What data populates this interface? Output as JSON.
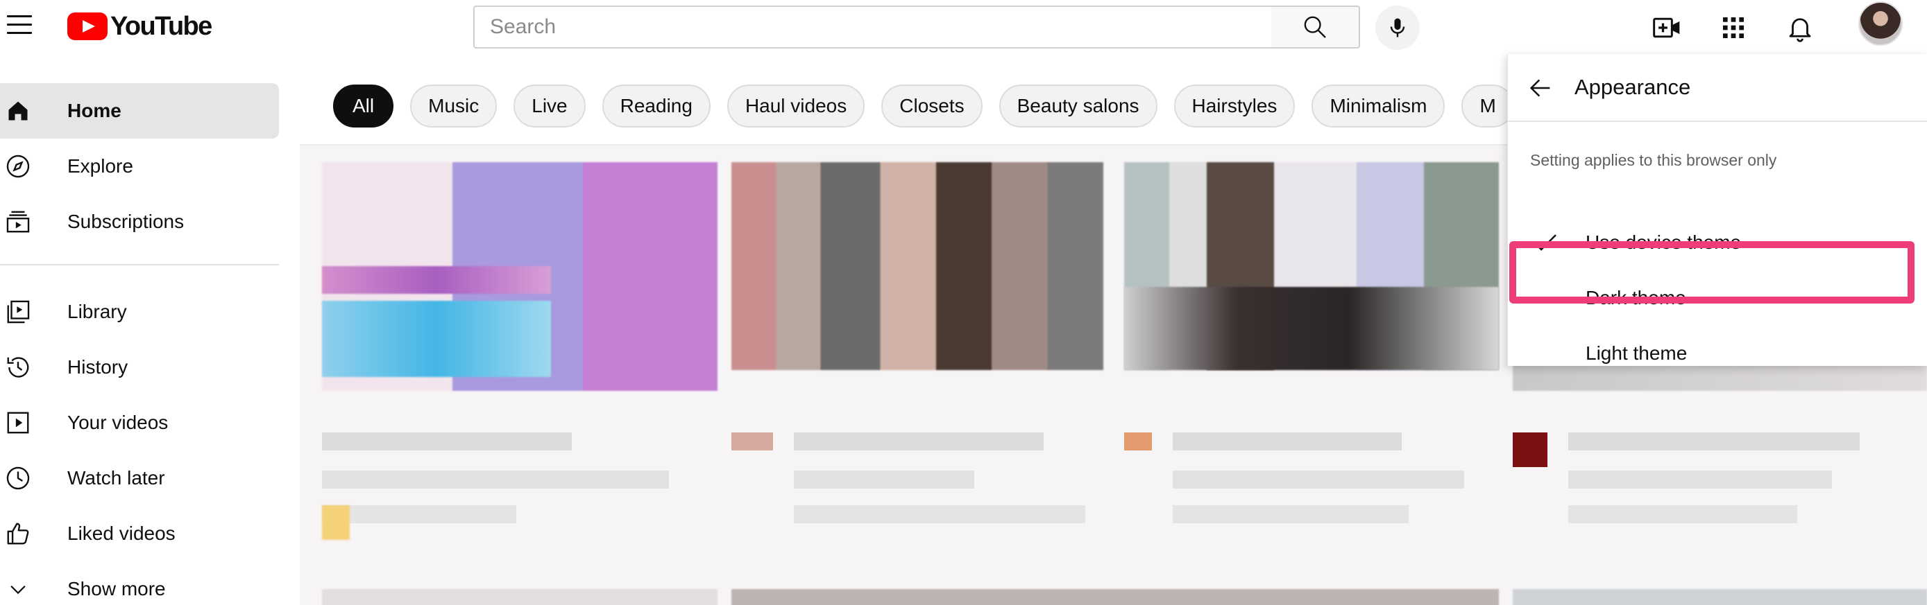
{
  "header": {
    "logo_text": "YouTube",
    "search_placeholder": "Search"
  },
  "icons": {
    "menu": "menu-icon",
    "search": "search-icon",
    "mic": "microphone-icon",
    "create": "create-video-icon",
    "apps": "apps-grid-icon",
    "notifications": "bell-icon"
  },
  "sidebar": {
    "items": [
      {
        "label": "Home",
        "icon": "home-icon",
        "active": true
      },
      {
        "label": "Explore",
        "icon": "compass-icon"
      },
      {
        "label": "Subscriptions",
        "icon": "subscriptions-icon"
      },
      {
        "label": "Library",
        "icon": "library-icon"
      },
      {
        "label": "History",
        "icon": "history-icon"
      },
      {
        "label": "Your videos",
        "icon": "your-videos-icon"
      },
      {
        "label": "Watch later",
        "icon": "clock-icon"
      },
      {
        "label": "Liked videos",
        "icon": "thumbs-up-icon"
      },
      {
        "label": "Show more",
        "icon": "chevron-down-icon"
      }
    ]
  },
  "chips": [
    "All",
    "Music",
    "Live",
    "Reading",
    "Haul videos",
    "Closets",
    "Beauty salons",
    "Hairstyles",
    "Minimalism",
    "M"
  ],
  "appearance": {
    "title": "Appearance",
    "note": "Setting applies to this browser only",
    "options": [
      {
        "label": "Use device theme",
        "selected": true
      },
      {
        "label": "Dark theme",
        "selected": false
      },
      {
        "label": "Light theme",
        "selected": false
      }
    ],
    "highlight_color": "#ef3d7a"
  },
  "colors": {
    "brand_red": "#ff0000",
    "text": "#0f0f0f",
    "chip_bg": "#f2f2f2",
    "active_chip_bg": "#0f0f0f"
  }
}
